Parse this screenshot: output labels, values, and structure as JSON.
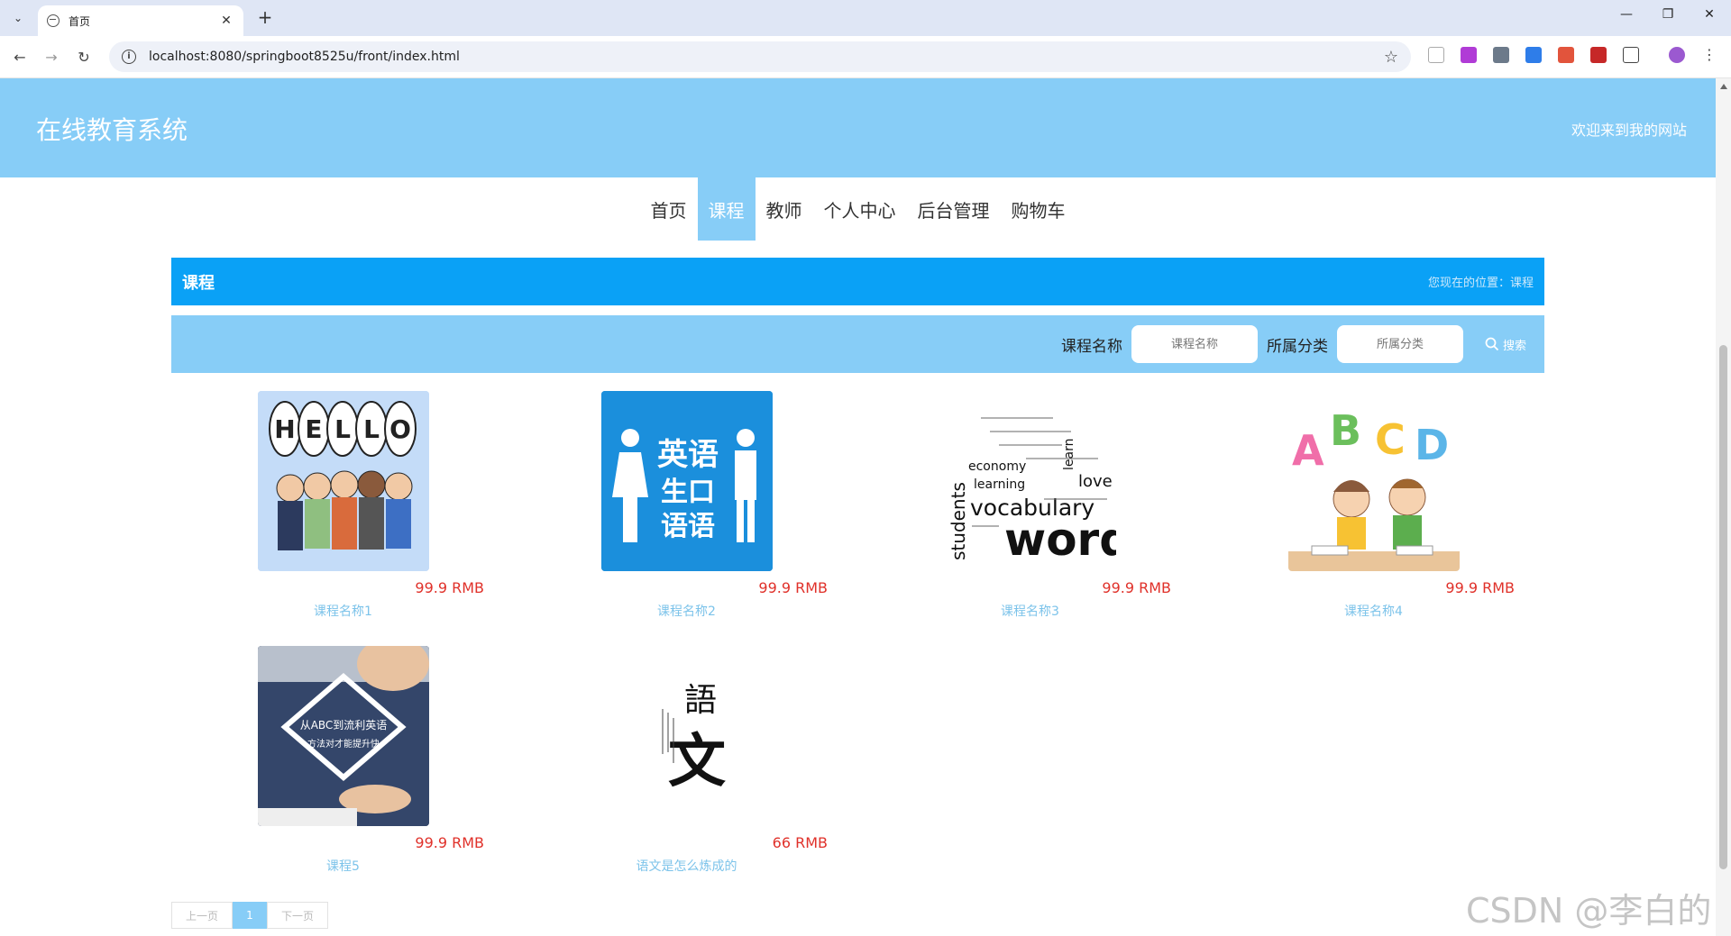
{
  "browser": {
    "tab_title": "首页",
    "url": "localhost:8080/springboot8525u/front/index.html"
  },
  "site": {
    "title": "在线教育系统",
    "welcome": "欢迎来到我的网站"
  },
  "nav": {
    "items": [
      {
        "label": "首页",
        "active": false
      },
      {
        "label": "课程",
        "active": true
      },
      {
        "label": "教师",
        "active": false
      },
      {
        "label": "个人中心",
        "active": false
      },
      {
        "label": "后台管理",
        "active": false
      },
      {
        "label": "购物车",
        "active": false
      }
    ]
  },
  "section": {
    "name": "课程",
    "breadcrumb": "您现在的位置：课程"
  },
  "search": {
    "name_label": "课程名称",
    "name_placeholder": "课程名称",
    "category_label": "所属分类",
    "category_placeholder": "所属分类",
    "button_label": "搜索"
  },
  "courses": [
    {
      "name": "课程名称1",
      "price": "99.9 RMB",
      "image": "hello-cartoon"
    },
    {
      "name": "课程名称2",
      "price": "99.9 RMB",
      "image": "english-speaking"
    },
    {
      "name": "课程名称3",
      "price": "99.9 RMB",
      "image": "vocabulary-words"
    },
    {
      "name": "课程名称4",
      "price": "99.9 RMB",
      "image": "abcd-kids"
    },
    {
      "name": "课程5",
      "price": "99.9 RMB",
      "image": "abc-fluent-english"
    },
    {
      "name": "语文是怎么炼成的",
      "price": "66 RMB",
      "image": "yuwen-calligraphy"
    }
  ],
  "images": {
    "english_text": [
      "英语",
      "生口",
      "语语"
    ],
    "vocab_text": [
      "vocabulary",
      "words",
      "students",
      "economy",
      "learning",
      "love",
      "learn"
    ],
    "abcd_letters": [
      "A",
      "B",
      "C",
      "D"
    ],
    "hello_letters": [
      "H",
      "E",
      "L",
      "L",
      "O"
    ],
    "abc_line1": "从ABC到流利英语",
    "abc_line2": "方法对才能提升快",
    "yuwen_chars": [
      "語",
      "文"
    ]
  },
  "pager": {
    "prev": "上一页",
    "current": "1",
    "next": "下一页"
  },
  "watermark": "CSDN @李白的粉"
}
